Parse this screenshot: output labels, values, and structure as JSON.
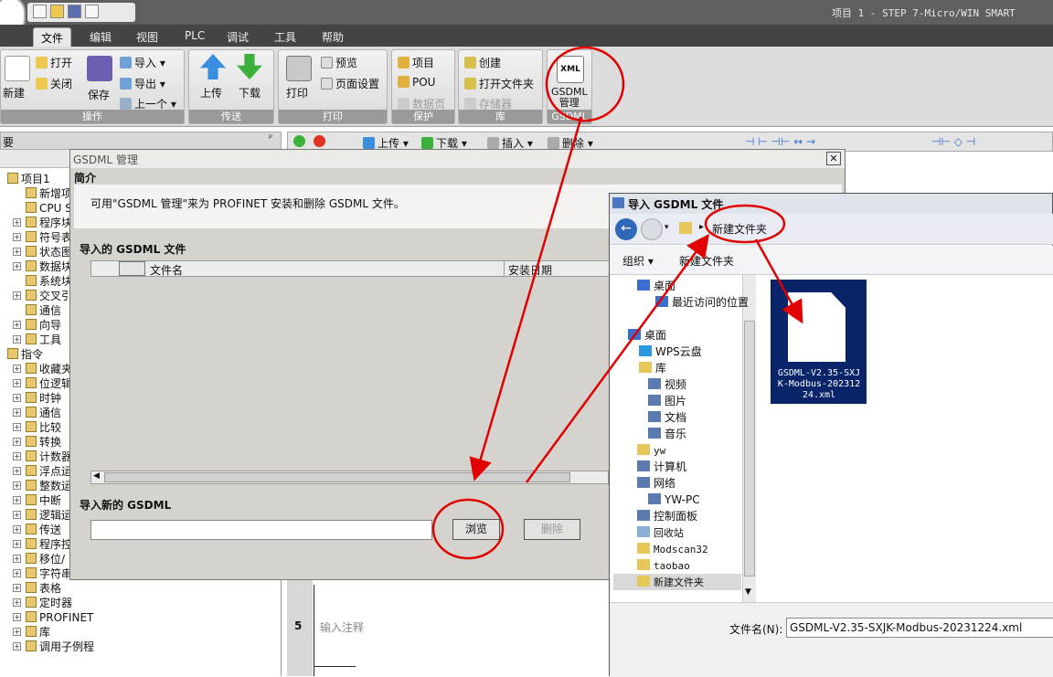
{
  "window": {
    "title": "项目 1 - STEP 7-Micro/WIN SMART"
  },
  "menu": {
    "tabs": [
      "文件",
      "编辑",
      "视图",
      "PLC",
      "调试",
      "工具",
      "帮助"
    ],
    "active": 0
  },
  "ribbon": {
    "groups": [
      "操作",
      "传送",
      "打印",
      "保护",
      "库",
      "GSDML"
    ],
    "new": "新建",
    "open": "打开",
    "close": "关闭",
    "save": "保存",
    "import": "导入",
    "export": "导出",
    "previous": "上一个",
    "upload": "上传",
    "download": "下载",
    "print": "打印",
    "preview": "预览",
    "page_setup": "页面设置",
    "project": "项目",
    "pou": "POU",
    "datapage": "数据页",
    "create": "创建",
    "open_folder": "打开文件夹",
    "storage": "存储器",
    "gsdml_icon_text": "XML",
    "gsdml_button": "GSDML\n管理"
  },
  "toolbar": {
    "panel_label": "要",
    "upload": "上传",
    "download": "下载",
    "insert": "插入",
    "delete": "删除"
  },
  "tree": {
    "project": "项目1",
    "items": [
      "新增项",
      "CPU S",
      "程序块",
      "符号表",
      "状态图",
      "数据块",
      "系统块",
      "交叉引",
      "通信",
      "向导",
      "工具"
    ],
    "instructions": "指令",
    "inst_items": [
      "收藏夹",
      "位逻辑",
      "时钟",
      "通信",
      "比较",
      "转换",
      "计数器",
      "浮点运",
      "整数运",
      "中断",
      "逻辑运",
      "传送",
      "程序控",
      "移位/",
      "字符串",
      "表格",
      "定时器",
      "PROFINET",
      "库",
      "调用子例程"
    ]
  },
  "editor": {
    "line_number": "5",
    "comment_placeholder": "输入注释"
  },
  "gsdml_dialog": {
    "title": "GSDML 管理",
    "intro_heading": "简介",
    "intro_text": "可用\"GSDML 管理\"来为 PROFINET 安装和删除 GSDML 文件。",
    "imported_heading": "导入的 GSDML 文件",
    "col_filename": "文件名",
    "col_install_date": "安装日期",
    "import_new_heading": "导入新的 GSDML",
    "path_value": "",
    "browse": "浏览",
    "delete": "删除",
    "close_symbol": "✕"
  },
  "import_dialog": {
    "title": "导入 GSDML 文件",
    "current_folder": "新建文件夹",
    "organize": "组织",
    "new_folder": "新建文件夹",
    "nav": [
      "桌面",
      "最近访问的位置",
      "桌面",
      "WPS云盘",
      "库",
      "视频",
      "图片",
      "文档",
      "音乐",
      "yw",
      "计算机",
      "网络",
      "YW-PC",
      "控制面板",
      "回收站",
      "Modscan32",
      "taobao",
      "新建文件夹"
    ],
    "file": "GSDML-V2.35-SXJK-Modbus-20231224.xml",
    "file_display": [
      "GSDML-V2.35-SXJ",
      "K-Modbus-202312",
      "24.xml"
    ],
    "filename_label": "文件名(N):",
    "filename_value": "GSDML-V2.35-SXJK-Modbus-20231224.xml"
  },
  "colors": {
    "annotation": "#e00000",
    "ribbon_bg": "#dcdcdc",
    "dialog_bg": "#d6d3ce",
    "selection": "#0a246a"
  }
}
